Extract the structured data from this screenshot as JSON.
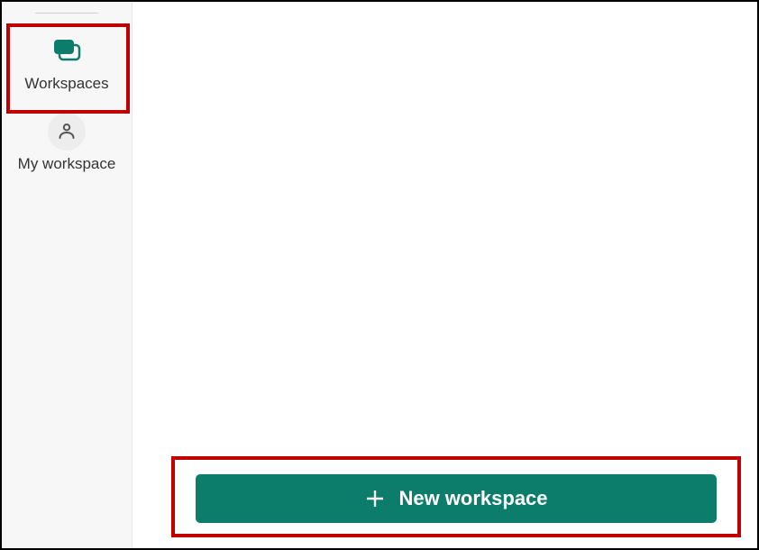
{
  "sidebar": {
    "items": [
      {
        "label": "Workspaces",
        "icon": "workspaces-stack-icon",
        "selected": true
      },
      {
        "label": "My workspace",
        "icon": "person-icon",
        "selected": false
      }
    ]
  },
  "main": {
    "new_workspace_button_label": "New workspace"
  },
  "colors": {
    "accent_teal": "#0d7d6b",
    "highlight_red": "#c00000",
    "sidebar_bg": "#f7f7f7"
  }
}
